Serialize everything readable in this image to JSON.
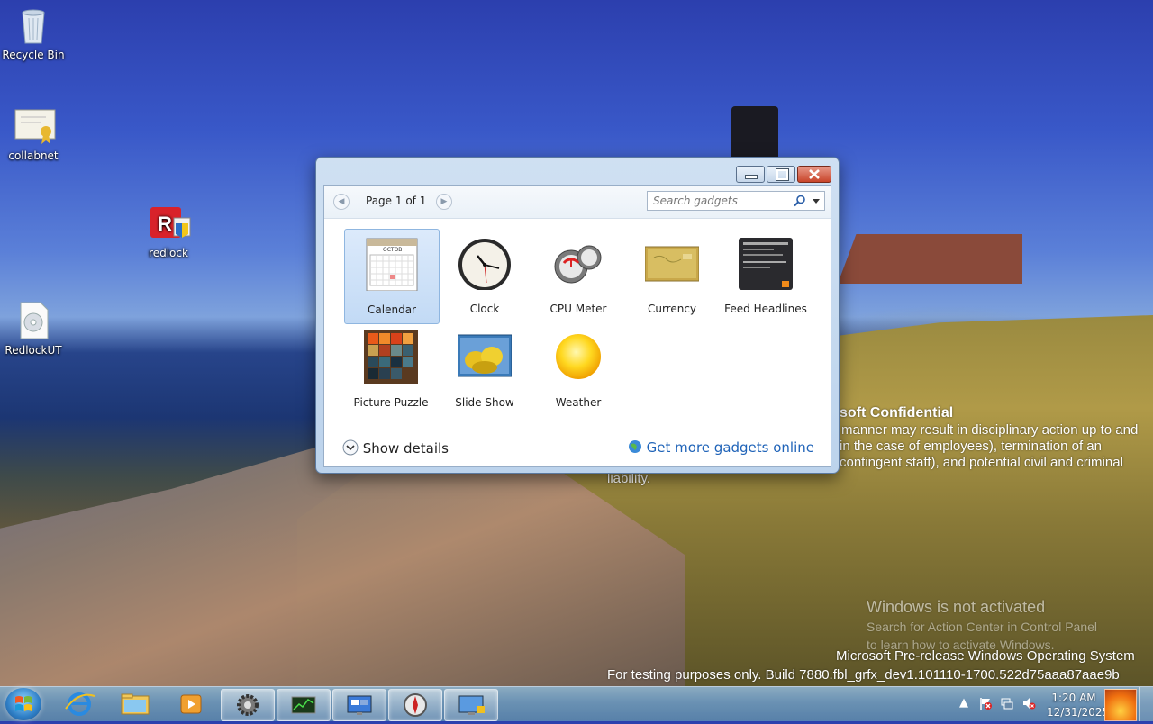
{
  "desktop": {
    "icons": [
      {
        "label": "Recycle Bin"
      },
      {
        "label": "collabnet"
      },
      {
        "label": "redlock"
      },
      {
        "label": "RedlockUT"
      }
    ],
    "confidential": {
      "title": "soft Confidential",
      "line1": "manner may result in disciplinary action up to and",
      "line2": "in the case of employees), termination of an",
      "line3": "contingent staff), and potential civil and criminal",
      "line4": "liability."
    },
    "activation": {
      "title": "Windows is not activated",
      "line1": "Search for Action Center in Control Panel",
      "line2": "to learn how to activate Windows."
    },
    "build": {
      "line1": "Microsoft Pre-release Windows Operating System",
      "line2": "For testing purposes only. Build 7880.fbl_grfx_dev1.101110-1700.522d75aaa87aae9b"
    }
  },
  "gadget_window": {
    "page_label": "Page 1 of 1",
    "search_placeholder": "Search gadgets",
    "gadgets": [
      {
        "label": "Calendar",
        "selected": true
      },
      {
        "label": "Clock"
      },
      {
        "label": "CPU Meter"
      },
      {
        "label": "Currency"
      },
      {
        "label": "Feed Headlines"
      },
      {
        "label": "Picture Puzzle"
      },
      {
        "label": "Slide Show"
      },
      {
        "label": "Weather"
      }
    ],
    "calendar_month": "OCTOB",
    "show_details": "Show details",
    "get_more": "Get more gadgets online"
  },
  "taskbar": {
    "pinned": [
      {
        "icon": "internet-explorer-icon"
      },
      {
        "icon": "file-explorer-icon"
      },
      {
        "icon": "media-player-icon"
      },
      {
        "icon": "control-panel-gear-icon"
      },
      {
        "icon": "task-manager-icon"
      },
      {
        "icon": "remote-desktop-icon"
      },
      {
        "icon": "gadgets-compass-icon"
      },
      {
        "icon": "display-settings-icon"
      }
    ],
    "time": "1:20 AM",
    "date": "12/31/2025"
  },
  "colors": {
    "link": "#1f63b8",
    "close_button": "#c8452a",
    "selection": "#c2daf5"
  }
}
